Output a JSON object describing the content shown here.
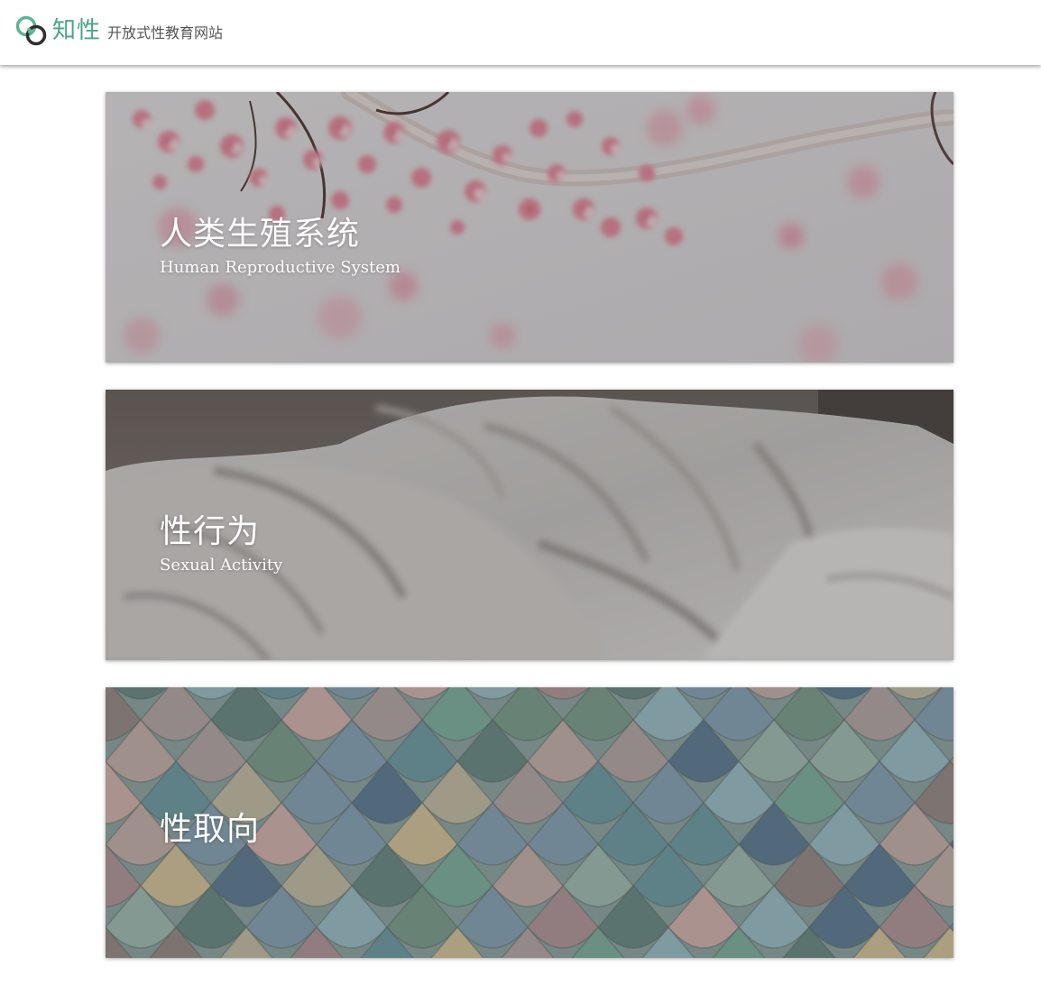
{
  "header": {
    "brand_name": "知性",
    "tagline": "开放式性教育网站",
    "logo_icon": "linked-rings-icon",
    "brand_color": "#4aa585"
  },
  "cards": [
    {
      "title": "人类生殖系统",
      "subtitle": "Human Reproductive System",
      "image": "cherry-blossom-branch"
    },
    {
      "title": "性行为",
      "subtitle": "Sexual Activity",
      "image": "rumpled-white-bedsheets"
    },
    {
      "title": "性取向",
      "subtitle": "",
      "image": "colorful-fish-scale-tiles"
    }
  ]
}
